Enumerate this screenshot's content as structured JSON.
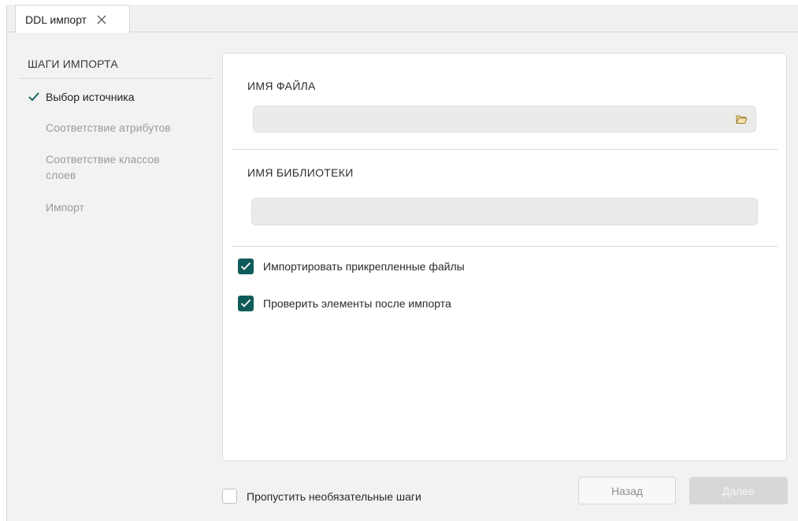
{
  "tab": {
    "title": "DDL импорт",
    "close_icon": "close-icon"
  },
  "sidebar": {
    "title": "ШАГИ ИМПОРТА",
    "steps": [
      {
        "label": "Выбор источника",
        "state": "done"
      },
      {
        "label": "Соответствие атрибутов",
        "state": "pending"
      },
      {
        "label": "Соответствие классов слоев",
        "state": "pending"
      },
      {
        "label": "Импорт",
        "state": "pending"
      }
    ]
  },
  "main": {
    "file_label": "ИМЯ ФАЙЛА",
    "file_value": "",
    "library_label": "ИМЯ БИБЛИОТЕКИ",
    "library_value": "",
    "options": [
      {
        "label": "Импортировать прикрепленные файлы",
        "checked": true
      },
      {
        "label": "Проверить элементы после импорта",
        "checked": true
      }
    ]
  },
  "footer": {
    "skip_label": "Пропустить необязательные шаги",
    "skip_checked": false,
    "back_label": "Назад",
    "next_label": "Далее"
  },
  "colors": {
    "accent": "#0f5b5a",
    "background": "#f1f2f1",
    "disabled_button": "#d6d8d6"
  }
}
